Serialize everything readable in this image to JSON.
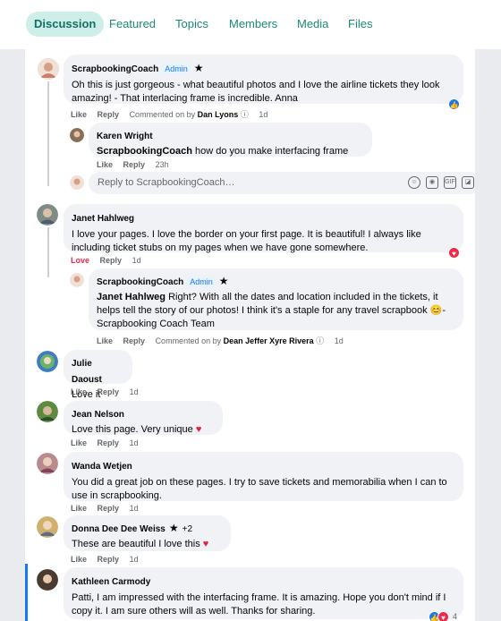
{
  "tabs": [
    "Discussion",
    "Featured",
    "Topics",
    "Members",
    "Media",
    "Files"
  ],
  "reply_placeholder": "Reply to ScrapbookingCoach…",
  "labels": {
    "like": "Like",
    "reply": "Reply",
    "love": "Love",
    "commented_on_by": "Commented on by",
    "admin": "Admin"
  },
  "comments": [
    {
      "name": "ScrapbookingCoach",
      "text": "Oh this is just gorgeous - what beautiful photos and I love the airline tickets they look amazing! - That interlacing frame is incredible. Anna",
      "time": "1d",
      "commented_by": "Dan Lyons"
    },
    {
      "name": "Karen Wright",
      "mention": "ScrapbookingCoach",
      "text": " how do you make interfacing frame",
      "time": "23h"
    },
    {
      "name": "Janet Hahlweg",
      "text": "I love your pages. I love the border on your first page. It is beautiful! I always like including ticket stubs on my pages when we have gone somewhere.",
      "time": "1d"
    },
    {
      "name": "ScrapbookingCoach",
      "mention": "Janet Hahlweg",
      "text": " Right? With all the dates and location included in the tickets, it helps tell the story of our photos! I think it's a staple for any travel scrapbook 😊-Scrapbooking Coach Team",
      "time": "1d",
      "commented_by": "Dean Jeffer Xyre Rivera"
    },
    {
      "name": "Julie Daoust",
      "text": "Love it",
      "time": "1d"
    },
    {
      "name": "Jean Nelson",
      "text": "Love this page. Very unique ",
      "time": "1d"
    },
    {
      "name": "Wanda Wetjen",
      "text": "You did a great job on these pages. I try to save tickets and memorabilia when I can to use in scrapbooking.",
      "time": "1d"
    },
    {
      "name": "Donna Dee Dee Weiss",
      "badge": "+2",
      "text": "These are beautiful I love this ",
      "time": "1d"
    },
    {
      "name": "Kathleen Carmody",
      "text": "Patti, I am impressed with the interfacing frame. It is amazing. Hope you don't mind if I copy it. I am sure others will as well. Thanks for sharing.",
      "reaction_count": "4"
    }
  ],
  "colors": {
    "accent": "#1b8a7c",
    "like_blue": "#1877f2",
    "love_red": "#f02849"
  }
}
